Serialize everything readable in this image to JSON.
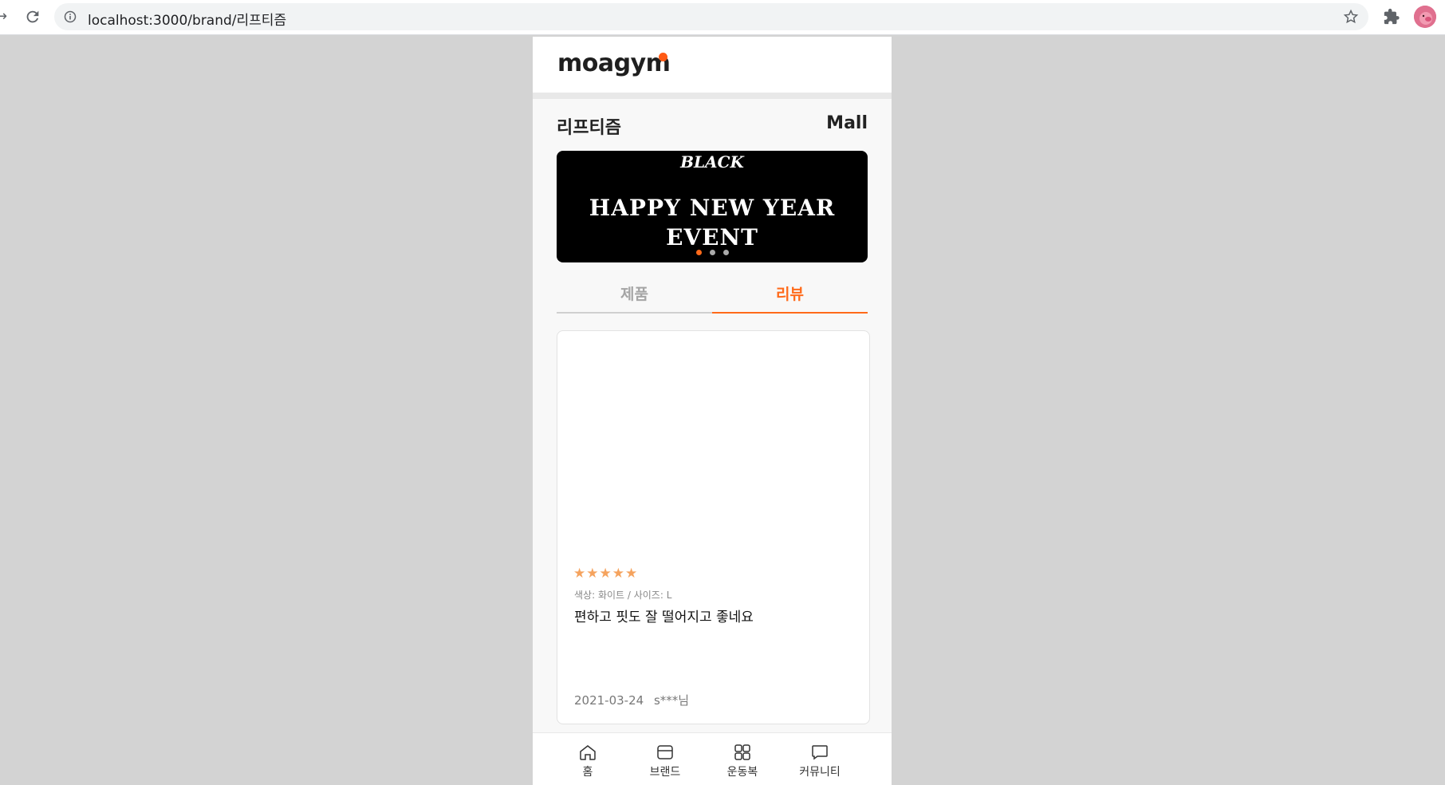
{
  "browser": {
    "url": "localhost:3000/brand/리프티즘"
  },
  "app": {
    "logo": "moagym",
    "brand_title": "리프티즘",
    "mall_link": "Mall",
    "banner": {
      "logo_text": "BLACK",
      "line1": "HAPPY NEW YEAR",
      "line2": "EVENT",
      "slide_count": 3,
      "active_slide": 0
    },
    "tabs": [
      {
        "label": "제품",
        "active": false
      },
      {
        "label": "리뷰",
        "active": true
      }
    ],
    "review": {
      "rating": 5,
      "stars": "★★★★★",
      "options": "색상: 화이트 / 사이즈: L",
      "text": "편하고 핏도 잘 떨어지고 좋네요",
      "date": "2021-03-24",
      "author": "s***님"
    },
    "bottom_nav": [
      {
        "label": "홈",
        "icon": "home-icon"
      },
      {
        "label": "브랜드",
        "icon": "store-icon"
      },
      {
        "label": "운동복",
        "icon": "grid-icon"
      },
      {
        "label": "커뮤니티",
        "icon": "chat-icon"
      }
    ]
  },
  "colors": {
    "accent": "#ff6a1a",
    "star": "#f5a35e",
    "page_bg": "#d3d3d3"
  }
}
